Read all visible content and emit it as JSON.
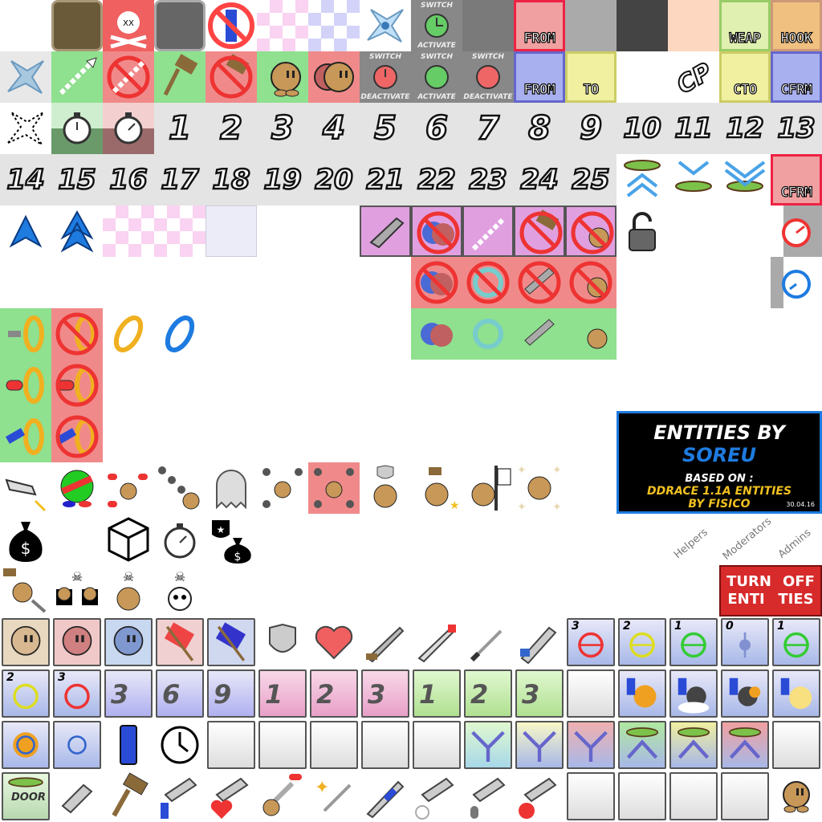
{
  "numbers": [
    "1",
    "2",
    "3",
    "4",
    "5",
    "6",
    "7",
    "8",
    "9",
    "10",
    "11",
    "12",
    "13",
    "14",
    "15",
    "16",
    "17",
    "18",
    "19",
    "20",
    "21",
    "22",
    "23",
    "24",
    "25"
  ],
  "tele_labels": {
    "from_1": "FROM",
    "weap": "WEAP",
    "hook": "HOOK",
    "from_2": "FROM",
    "to": "TO",
    "cto": "CTO",
    "cfrm_1": "CFRM",
    "cfrm_2": "CFRM"
  },
  "switch_labels": {
    "switch": "SWITCH",
    "activate": "ACTIVATE",
    "deactivate": "DEACTIVATE"
  },
  "credit": {
    "title_a": "ENTITIES BY",
    "title_b": "SOREU",
    "based_on": "BASED ON :",
    "ddrace": "DDRACE 1.1A ENTITIES",
    "by": "BY FISICO",
    "date": "30.04.16"
  },
  "roles": [
    "Helpers",
    "Moderators",
    "Admins"
  ],
  "turn_off": {
    "line1": "TURN",
    "line2": "OFF",
    "line3": "ENTI",
    "line4": "TIES"
  },
  "door_label": "DOOR",
  "laser_counts": [
    "3",
    "2",
    "1",
    "0",
    "1",
    "2",
    "3"
  ],
  "stopper_counts": [
    "3",
    "6",
    "9",
    "1",
    "2",
    "3",
    "1",
    "2",
    "3"
  ],
  "colors": {
    "green_bg": "#8fe08f",
    "red_bg": "#f08a8a",
    "pink_bg": "#f4c0d8",
    "blue_bg": "#a8b0f0",
    "yellow_bg": "#f0f0a0",
    "gray_bg": "#d8d8d8",
    "accent_blue": "#1e7be0",
    "tee_brown": "#c89858"
  }
}
